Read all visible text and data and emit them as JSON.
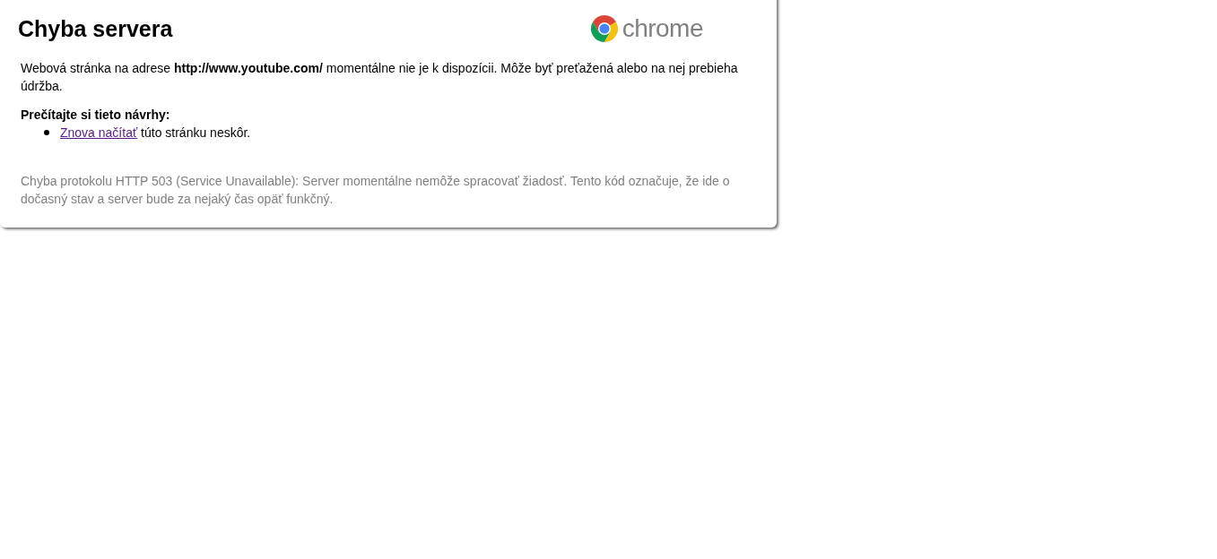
{
  "title": "Chyba servera",
  "logo": {
    "text": "chrome"
  },
  "message": "Webová stránka na adrese **http://www.youtube.com/** momentálne nie je k dispozícii. Môže byť preťažená alebo na nej prebieha údržba.",
  "suggestions_heading": "Prečítajte si tieto návrhy:",
  "suggestions": [
    {
      "link": "Znova načítať",
      "text": " túto stránku neskôr."
    }
  ],
  "error_detail": "Chyba protokolu HTTP 503 (Service Unavailable): Server momentálne nemôže spracovať žiadosť. Tento kód označuje, že ide o dočasný stav a server bude za nejaký čas opäť funkčný."
}
